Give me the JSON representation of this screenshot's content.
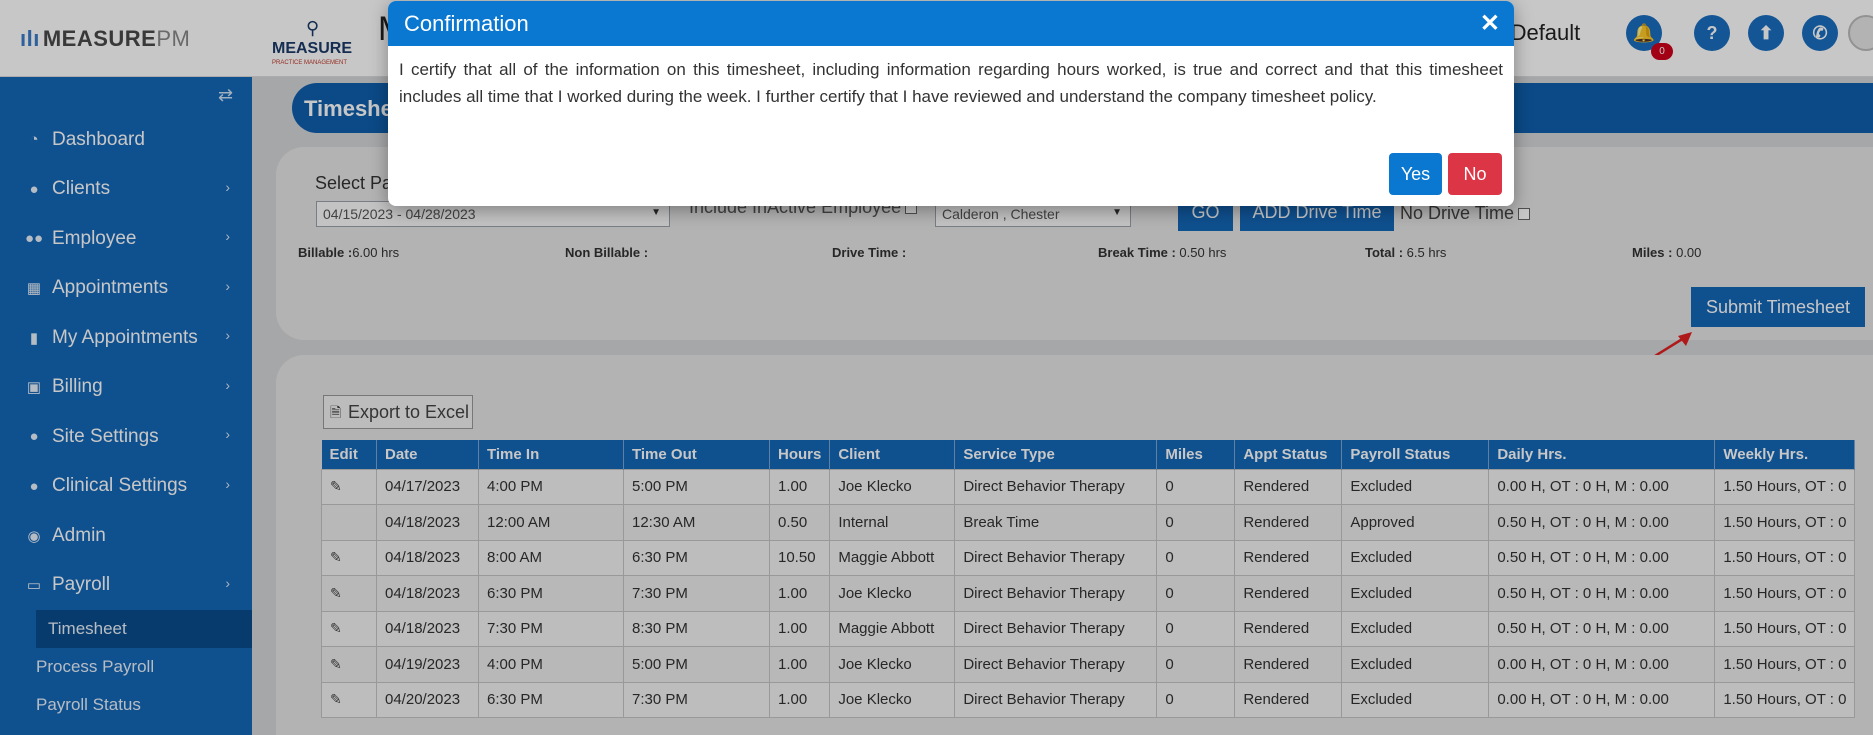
{
  "header": {
    "brand_name": "MEASURE",
    "brand_suffix": "PM",
    "logo_text": "MEASURE",
    "logo_subtext": "PRACTICE MANAGEMENT",
    "partial_title": "M",
    "user_name": "e , Default",
    "notification_count": "0"
  },
  "sidebar": {
    "items": [
      {
        "label": "Dashboard",
        "icon": "dashboard-icon"
      },
      {
        "label": "Clients",
        "icon": "user-icon"
      },
      {
        "label": "Employee",
        "icon": "users-icon"
      },
      {
        "label": "Appointments",
        "icon": "calendar-icon"
      },
      {
        "label": "My Appointments",
        "icon": "clipboard-icon"
      },
      {
        "label": "Billing",
        "icon": "money-icon"
      },
      {
        "label": "Site Settings",
        "icon": "user-icon"
      },
      {
        "label": "Clinical Settings",
        "icon": "user-icon"
      },
      {
        "label": "Admin",
        "icon": "user-circle-icon"
      },
      {
        "label": "Payroll",
        "icon": "credit-card-icon"
      }
    ],
    "subitems": [
      "Timesheet",
      "Process Payroll",
      "Payroll Status"
    ]
  },
  "page": {
    "title": "Timeshe",
    "select_label": "Select Pay",
    "pay_period": "04/15/2023 - 04/28/2023",
    "include_inactive": "Include InActive Employee",
    "employee": "Calderon , Chester",
    "go_label": "GO",
    "add_drive_label": "ADD Drive Time",
    "no_drive_label": "No Drive Time",
    "submit_label": "Submit Timesheet",
    "export_label": "Export to Excel"
  },
  "stats": {
    "billable_label": "Billable :",
    "billable_value": "6.00 hrs",
    "nonbillable_label": "Non Billable :",
    "nonbillable_value": "",
    "drive_label": "Drive Time :",
    "drive_value": "",
    "break_label": "Break Time :",
    "break_value": "0.50 hrs",
    "total_label": "Total :",
    "total_value": "6.5 hrs",
    "miles_label": "Miles :",
    "miles_value": "0.00"
  },
  "table": {
    "headers": [
      "Edit",
      "Date",
      "Time In",
      "Time Out",
      "Hours",
      "Client",
      "Service Type",
      "Miles",
      "Appt Status",
      "Payroll Status",
      "Daily Hrs.",
      "Weekly Hrs."
    ],
    "rows": [
      {
        "edit": true,
        "date": "04/17/2023",
        "in": "4:00 PM",
        "out": "5:00 PM",
        "hours": "1.00",
        "client": "Joe Klecko",
        "service": "Direct Behavior Therapy",
        "miles": "0",
        "appt": "Rendered",
        "payroll": "Excluded",
        "daily": "0.00 H, OT : 0 H, M : 0.00",
        "weekly": "1.50 Hours, OT : 0"
      },
      {
        "edit": false,
        "date": "04/18/2023",
        "in": "12:00 AM",
        "out": "12:30 AM",
        "hours": "0.50",
        "client": "Internal",
        "service": "Break Time",
        "miles": "0",
        "appt": "Rendered",
        "payroll": "Approved",
        "daily": "0.50 H, OT : 0 H, M : 0.00",
        "weekly": "1.50 Hours, OT : 0"
      },
      {
        "edit": true,
        "date": "04/18/2023",
        "in": "8:00 AM",
        "out": "6:30 PM",
        "hours": "10.50",
        "client": "Maggie Abbott",
        "service": "Direct Behavior Therapy",
        "miles": "0",
        "appt": "Rendered",
        "payroll": "Excluded",
        "daily": "0.50 H, OT : 0 H, M : 0.00",
        "weekly": "1.50 Hours, OT : 0"
      },
      {
        "edit": true,
        "date": "04/18/2023",
        "in": "6:30 PM",
        "out": "7:30 PM",
        "hours": "1.00",
        "client": "Joe Klecko",
        "service": "Direct Behavior Therapy",
        "miles": "0",
        "appt": "Rendered",
        "payroll": "Excluded",
        "daily": "0.50 H, OT : 0 H, M : 0.00",
        "weekly": "1.50 Hours, OT : 0"
      },
      {
        "edit": true,
        "date": "04/18/2023",
        "in": "7:30 PM",
        "out": "8:30 PM",
        "hours": "1.00",
        "client": "Maggie Abbott",
        "service": "Direct Behavior Therapy",
        "miles": "0",
        "appt": "Rendered",
        "payroll": "Excluded",
        "daily": "0.50 H, OT : 0 H, M : 0.00",
        "weekly": "1.50 Hours, OT : 0"
      },
      {
        "edit": true,
        "date": "04/19/2023",
        "in": "4:00 PM",
        "out": "5:00 PM",
        "hours": "1.00",
        "client": "Joe Klecko",
        "service": "Direct Behavior Therapy",
        "miles": "0",
        "appt": "Rendered",
        "payroll": "Excluded",
        "daily": "0.00 H, OT : 0 H, M : 0.00",
        "weekly": "1.50 Hours, OT : 0"
      },
      {
        "edit": true,
        "date": "04/20/2023",
        "in": "6:30 PM",
        "out": "7:30 PM",
        "hours": "1.00",
        "client": "Joe Klecko",
        "service": "Direct Behavior Therapy",
        "miles": "0",
        "appt": "Rendered",
        "payroll": "Excluded",
        "daily": "0.00 H, OT : 0 H, M : 0.00",
        "weekly": "1.50 Hours, OT : 0"
      }
    ]
  },
  "modal": {
    "title": "Confirmation",
    "body": "I certify that all of the information on this timesheet, including information regarding hours worked, is true and correct and that this timesheet includes all time that I worked during the week. I further certify that I have reviewed and understand the company timesheet policy.",
    "yes_label": "Yes",
    "no_label": "No"
  },
  "colors": {
    "primary": "#1467b8",
    "modal_header": "#0a78d0",
    "danger": "#dc3545",
    "annotation_arrow": "#e02020"
  }
}
